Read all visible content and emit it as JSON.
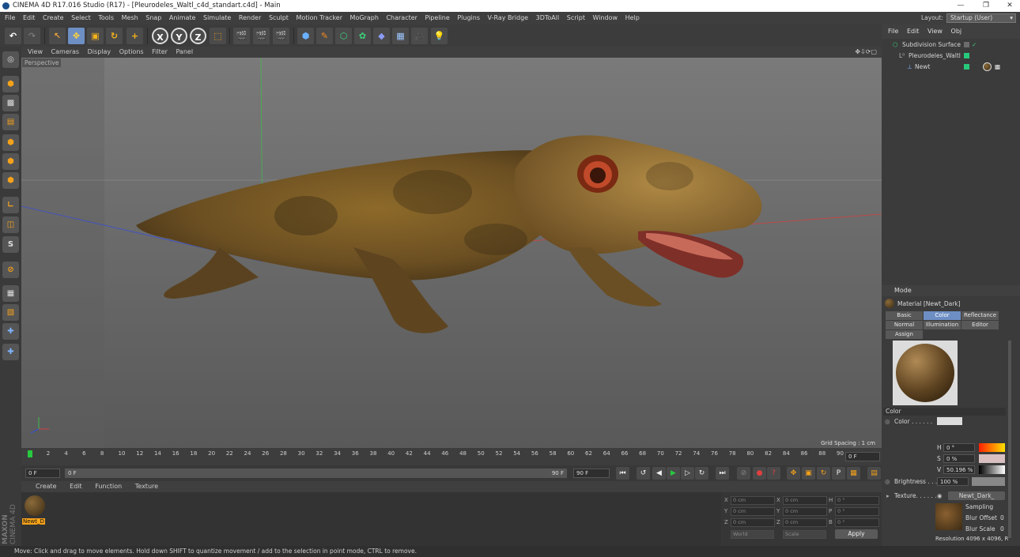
{
  "window": {
    "title": "CINEMA 4D R17.016 Studio (R17) - [Pleurodeles_Waltl_c4d_standart.c4d] - Main",
    "minimize": "—",
    "maximize": "❐",
    "close": "✕"
  },
  "menubar": [
    "File",
    "Edit",
    "Create",
    "Select",
    "Tools",
    "Mesh",
    "Snap",
    "Animate",
    "Simulate",
    "Render",
    "Sculpt",
    "Motion Tracker",
    "MoGraph",
    "Character",
    "Pipeline",
    "Plugins",
    "V-Ray Bridge",
    "3DToAll",
    "Script",
    "Window",
    "Help"
  ],
  "layout": {
    "label": "Layout:",
    "value": "Startup (User)"
  },
  "toolbar": {
    "x_axis": "X",
    "y_axis": "Y",
    "z_axis": "Z"
  },
  "viewport": {
    "menu": [
      "View",
      "Cameras",
      "Display",
      "Options",
      "Filter",
      "Panel"
    ],
    "camera_label": "Perspective",
    "grid_spacing": "Grid Spacing : 1 cm"
  },
  "timeline": {
    "ticks": [
      "0",
      "2",
      "4",
      "6",
      "8",
      "10",
      "12",
      "14",
      "16",
      "18",
      "20",
      "22",
      "24",
      "26",
      "28",
      "30",
      "32",
      "34",
      "36",
      "38",
      "40",
      "42",
      "44",
      "46",
      "48",
      "50",
      "52",
      "54",
      "56",
      "58",
      "60",
      "62",
      "64",
      "66",
      "68",
      "70",
      "72",
      "74",
      "76",
      "78",
      "80",
      "82",
      "84",
      "86",
      "88",
      "90"
    ],
    "current_frame": "0 F",
    "start_field": "0 F",
    "range_start": "0 F",
    "range_end": "90 F",
    "end_field": "90 F"
  },
  "material_manager": {
    "menu": [
      "Create",
      "Edit",
      "Function",
      "Texture"
    ],
    "material_name": "Newt_D"
  },
  "coordinates": {
    "rows": [
      {
        "a": "X",
        "av": "0 cm",
        "b": "X",
        "bv": "0 cm",
        "c": "H",
        "cv": "0 °"
      },
      {
        "a": "Y",
        "av": "0 cm",
        "b": "Y",
        "bv": "0 cm",
        "c": "P",
        "cv": "0 °"
      },
      {
        "a": "Z",
        "av": "0 cm",
        "b": "Z",
        "bv": "0 cm",
        "c": "B",
        "cv": "0 °"
      }
    ],
    "mode1": "World",
    "mode2": "Scale",
    "apply": "Apply"
  },
  "object_manager": {
    "menu": [
      "File",
      "Edit",
      "View",
      "Obj"
    ],
    "items": [
      {
        "name": "Subdivision Surface",
        "indent": 0
      },
      {
        "name": "Pleurodeles_Waltl",
        "indent": 1
      },
      {
        "name": "Newt",
        "indent": 2
      }
    ]
  },
  "attributes": {
    "mode": "Mode",
    "material_title": "Material [Newt_Dark]",
    "tabs_row1": [
      "Basic",
      "Color",
      "Reflectance"
    ],
    "tabs_row2": [
      "Normal",
      "Illumination",
      "Editor"
    ],
    "tabs_row3": [
      "Assign"
    ],
    "active_tab": "Color",
    "section": "Color",
    "color_label": "Color . . . . . .",
    "h_label": "H",
    "h_value": "0 °",
    "s_label": "S",
    "s_value": "0 %",
    "v_label": "V",
    "v_value": "50.196 %",
    "brightness_label": "Brightness . . .",
    "brightness_value": "100 %",
    "texture_label": "Texture. . . . . .",
    "texture_value": "Newt_Dark_",
    "sampling": "Sampling",
    "blur_offset": "Blur Offset",
    "blur_offset_value": "0",
    "blur_scale": "Blur Scale",
    "blur_scale_value": "0",
    "resolution": "Resolution 4096 x 4096, R"
  },
  "status": "Move: Click and drag to move elements. Hold down SHIFT to quantize movement / add to the selection in point mode, CTRL to remove.",
  "brand": {
    "maxon": "MAXON",
    "cinema": "CINEMA 4D"
  }
}
